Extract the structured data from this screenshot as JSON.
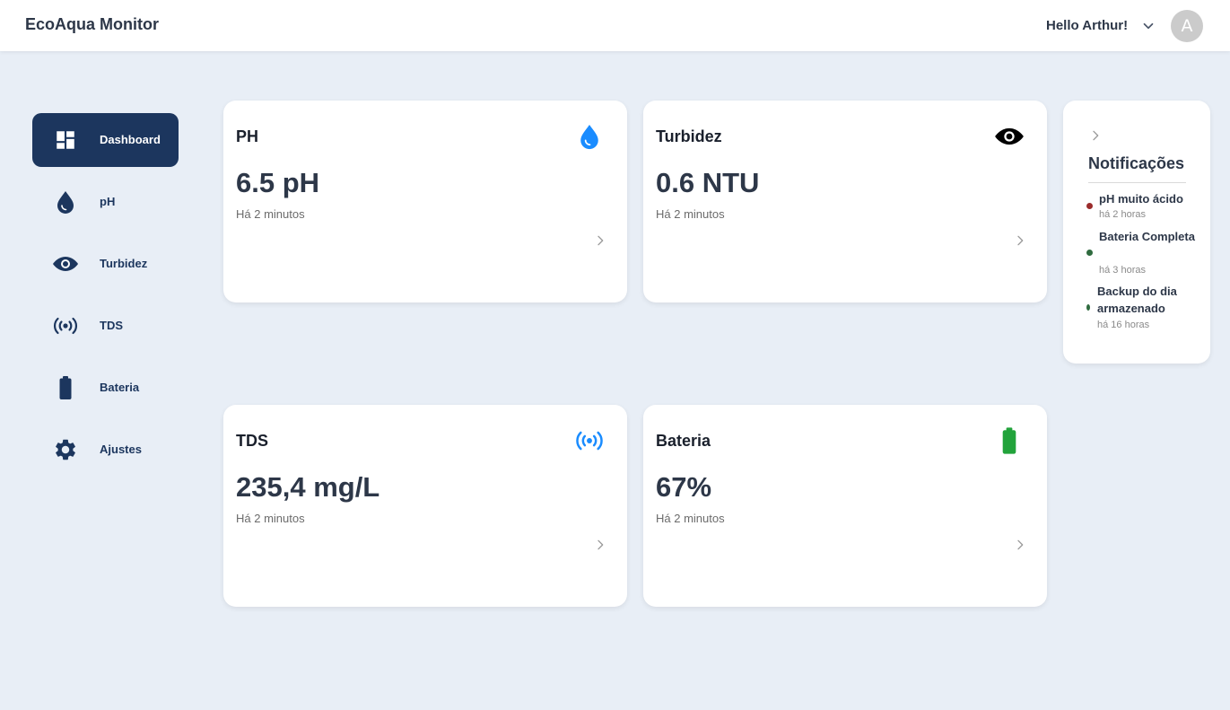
{
  "header": {
    "app_title": "EcoAqua Monitor",
    "greeting": "Hello Arthur!",
    "avatar_initial": "A"
  },
  "sidebar": {
    "items": [
      {
        "label": "Dashboard",
        "icon": "dashboard-icon",
        "active": true
      },
      {
        "label": "pH",
        "icon": "water-drop-icon",
        "active": false
      },
      {
        "label": "Turbidez",
        "icon": "eye-icon",
        "active": false
      },
      {
        "label": "TDS",
        "icon": "radio-waves-icon",
        "active": false
      },
      {
        "label": "Bateria",
        "icon": "battery-icon",
        "active": false
      },
      {
        "label": "Ajustes",
        "icon": "gear-icon",
        "active": false
      }
    ]
  },
  "cards": [
    {
      "title": "PH",
      "value": "6.5 pH",
      "time": "Há 2 minutos",
      "icon": "water-drop-icon",
      "icon_color": "#1a8cff"
    },
    {
      "title": "Turbidez",
      "value": "0.6 NTU",
      "time": "Há 2 minutos",
      "icon": "eye-icon",
      "icon_color": "#000000"
    },
    {
      "title": "TDS",
      "value": "235,4 mg/L",
      "time": "Há 2 minutos",
      "icon": "radio-waves-icon",
      "icon_color": "#1a8cff"
    },
    {
      "title": "Bateria",
      "value": "67%",
      "time": "Há 2 minutos",
      "icon": "battery-icon",
      "icon_color": "#22a33b"
    }
  ],
  "notifications": {
    "title": "Notificações",
    "items": [
      {
        "text": "pH muito ácido",
        "time": "há 2 horas",
        "dot_color": "#9b2c2c"
      },
      {
        "text": "Bateria Completa",
        "time": "há 3 horas",
        "dot_color": "#2f6b3f"
      },
      {
        "text": "Backup do dia armazenado",
        "time": "há 16 horas",
        "dot_color": "#2f6b3f"
      }
    ]
  },
  "colors": {
    "primary": "#1c365e",
    "background": "#e8eef6"
  }
}
